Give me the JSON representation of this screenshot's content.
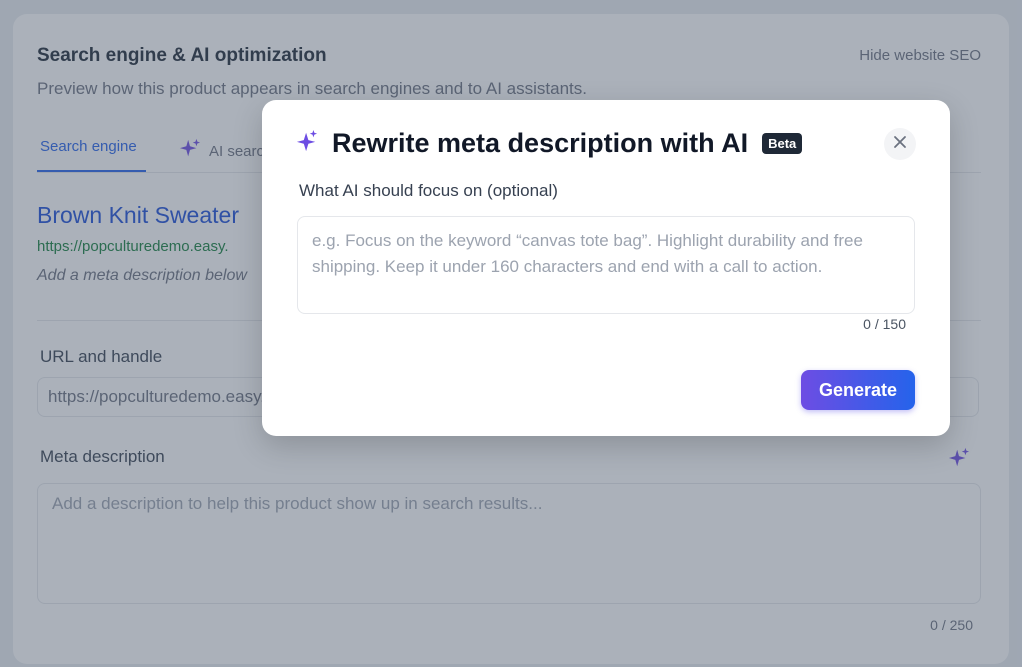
{
  "section": {
    "title": "Search engine & AI optimization",
    "hide_link": "Hide website SEO",
    "subtitle": "Preview how this product appears in search engines and to AI assistants."
  },
  "tabs": [
    {
      "label": "Search engine",
      "active": true
    },
    {
      "label": "AI search",
      "active": false
    }
  ],
  "preview": {
    "title": "Brown Knit Sweater",
    "url": "https://popculturedemo.easy.",
    "description": "Add a meta description below"
  },
  "url_field": {
    "label": "URL and handle",
    "value": "https://popculturedemo.easy."
  },
  "meta_field": {
    "label": "Meta description",
    "placeholder": "Add a description to help this product show up in search results...",
    "count": "0 / 250"
  },
  "modal": {
    "title": "Rewrite meta description with AI",
    "badge": "Beta",
    "focus_label": "What AI should focus on (optional)",
    "focus_placeholder": "e.g. Focus on the keyword “canvas tote bag”. Highlight durability and free shipping. Keep it under 160 characters and end with a call to action.",
    "count": "0 / 150",
    "generate_label": "Generate"
  },
  "colors": {
    "accent": "#2563eb",
    "ai_sparkle": "#6d4de3",
    "link_green": "#15803d"
  },
  "icons": {
    "sparkle": "sparkles-icon",
    "close": "close-icon"
  }
}
